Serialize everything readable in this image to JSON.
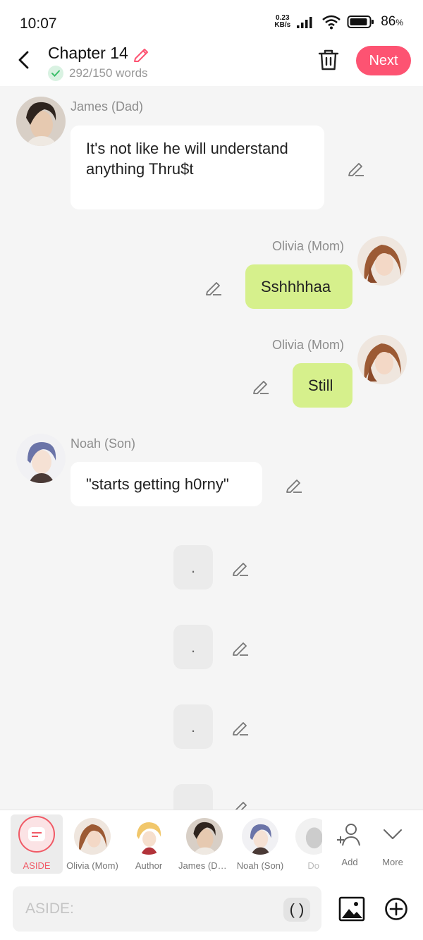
{
  "status_bar": {
    "time": "10:07",
    "net_speed_value": "0.23",
    "net_speed_unit": "KB/s",
    "battery_pct": "86",
    "battery_unit": "%"
  },
  "header": {
    "title": "Chapter 14",
    "word_count": "292/150 words",
    "next_label": "Next"
  },
  "messages": [
    {
      "speaker": "James (Dad)",
      "text": "It's not like he will understand anything Thru$t",
      "side": "left",
      "style": "white"
    },
    {
      "speaker": "Olivia (Mom)",
      "text": "Sshhhhaa",
      "side": "right",
      "style": "green"
    },
    {
      "speaker": "Olivia (Mom)",
      "text": "Still",
      "side": "right",
      "style": "green"
    },
    {
      "speaker": "Noah (Son)",
      "text": "\"starts getting h0rny\"",
      "side": "left",
      "style": "white"
    },
    {
      "speaker": "",
      "text": ".",
      "side": "center",
      "style": "aside"
    },
    {
      "speaker": "",
      "text": ".",
      "side": "center",
      "style": "aside"
    },
    {
      "speaker": "",
      "text": ".",
      "side": "center",
      "style": "aside"
    }
  ],
  "characters": [
    {
      "label": "ASIDE"
    },
    {
      "label": "Olivia (Mom)"
    },
    {
      "label": "Author"
    },
    {
      "label": "James (Dad)"
    },
    {
      "label": "Noah (Son)"
    },
    {
      "label": "Do"
    }
  ],
  "actions": {
    "add_label": "Add",
    "more_label": "More"
  },
  "input": {
    "placeholder": "ASIDE:",
    "paren_label": "( )"
  },
  "colors": {
    "accent": "#fd5372",
    "bubble_green": "#d6f08c",
    "bubble_white": "#ffffff",
    "background": "#f5f5f5"
  }
}
